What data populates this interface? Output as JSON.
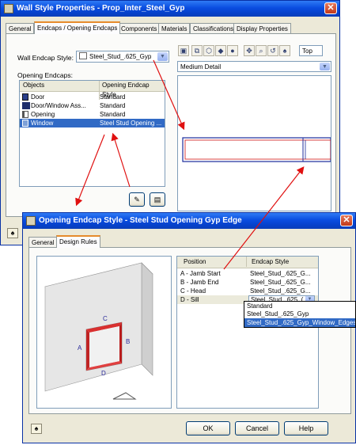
{
  "wall_style_window": {
    "title": "Wall Style Properties - Prop_Inter_Steel_Gyp",
    "tabs": [
      "General",
      "Endcaps / Opening Endcaps",
      "Components",
      "Materials",
      "Classifications",
      "Display Properties"
    ],
    "wall_endcap_label": "Wall Endcap Style:",
    "wall_endcap_value": "Steel_Stud_.625_Gyp",
    "opening_endcaps_label": "Opening Endcaps:",
    "columns": [
      "Objects",
      "Opening Endcap Style"
    ],
    "rows": [
      {
        "object": "Door",
        "style": "Standard",
        "icon": "door-icon"
      },
      {
        "object": "Door/Window Ass...",
        "style": "Standard",
        "icon": "door-window-assembly-icon"
      },
      {
        "object": "Opening",
        "style": "Standard",
        "icon": "opening-icon"
      },
      {
        "object": "Window",
        "style": "Steel Stud Opening ...",
        "icon": "window-icon"
      }
    ],
    "preview_view_label": "Top",
    "preview_detail": "Medium Detail"
  },
  "endcap_window": {
    "title": "Opening Endcap Style - Steel Stud Opening Gyp Edge",
    "tabs": [
      "General",
      "Design Rules"
    ],
    "columns": [
      "Position",
      "Endcap Style"
    ],
    "rows": [
      {
        "position": "A - Jamb Start",
        "style": "Steel_Stud_.625_G..."
      },
      {
        "position": "B - Jamb End",
        "style": "Steel_Stud_.625_G..."
      },
      {
        "position": "C - Head",
        "style": "Steel_Stud_.625_G..."
      },
      {
        "position": "D - Sill",
        "style": "Steel_Stud_.625_("
      }
    ],
    "dropdown_options": [
      "Standard",
      "Steel_Stud_.625_Gyp",
      "Steel_Stud_.625_Gyp_Window_Edges"
    ],
    "dropdown_selected_index": 2,
    "wall_labels": {
      "a": "A",
      "b": "B",
      "c": "C",
      "d": "D"
    },
    "buttons": {
      "ok": "OK",
      "cancel": "Cancel",
      "help": "Help"
    }
  },
  "colors": {
    "accent_arrow": "#e01010",
    "selection": "#316ac5",
    "title_bar": "#0a4de0"
  }
}
